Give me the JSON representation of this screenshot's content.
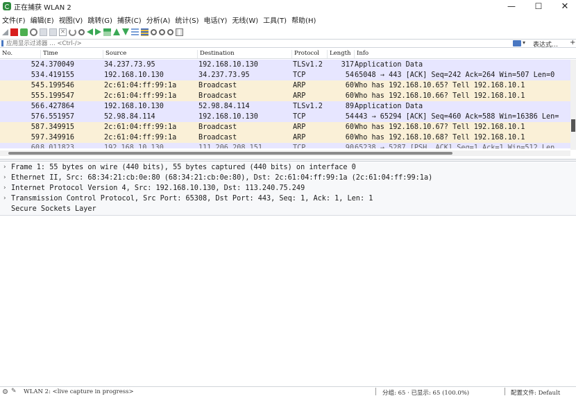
{
  "window": {
    "title": "正在捕获 WLAN 2",
    "minimize": "—",
    "maximize": "☐",
    "close": "✕"
  },
  "menu": [
    "文件(F)",
    "编辑(E)",
    "视图(V)",
    "跳转(G)",
    "捕获(C)",
    "分析(A)",
    "统计(S)",
    "电话(Y)",
    "无线(W)",
    "工具(T)",
    "帮助(H)"
  ],
  "toolbar_icons": [
    "shark-fin-icon",
    "stop-capture-icon",
    "restart-capture-icon",
    "capture-options-icon",
    "open-file-icon",
    "save-file-icon",
    "close-file-icon",
    "reload-icon",
    "find-packet-icon",
    "go-back-icon",
    "go-forward-icon",
    "go-to-packet-icon",
    "go-first-icon",
    "go-last-icon",
    "auto-scroll-icon",
    "colorize-icon",
    "zoom-in-icon",
    "zoom-out-icon",
    "zoom-normal-icon",
    "resize-columns-icon"
  ],
  "filter": {
    "placeholder": "应用显示过滤器 … <Ctrl-/>",
    "dropdown": "▾",
    "expression_label": "表达式…",
    "add_label": "+"
  },
  "columns": [
    "No.",
    "Time",
    "Source",
    "Destination",
    "Protocol",
    "Length",
    "Info"
  ],
  "packets": [
    {
      "no": "52",
      "time": "4.370049",
      "src": "34.237.73.95",
      "dst": "192.168.10.130",
      "proto": "TLSv1.2",
      "len": "317",
      "info": "Application Data",
      "bg": "#e7e6ff"
    },
    {
      "no": "53",
      "time": "4.419155",
      "src": "192.168.10.130",
      "dst": "34.237.73.95",
      "proto": "TCP",
      "len": "54",
      "info": "65048 → 443 [ACK] Seq=242 Ack=264 Win=507 Len=0",
      "bg": "#e7e6ff"
    },
    {
      "no": "54",
      "time": "5.199546",
      "src": "2c:61:04:ff:99:1a",
      "dst": "Broadcast",
      "proto": "ARP",
      "len": "60",
      "info": "Who has 192.168.10.65? Tell 192.168.10.1",
      "bg": "#faf0d7"
    },
    {
      "no": "55",
      "time": "5.199547",
      "src": "2c:61:04:ff:99:1a",
      "dst": "Broadcast",
      "proto": "ARP",
      "len": "60",
      "info": "Who has 192.168.10.66? Tell 192.168.10.1",
      "bg": "#faf0d7"
    },
    {
      "no": "56",
      "time": "6.427864",
      "src": "192.168.10.130",
      "dst": "52.98.84.114",
      "proto": "TLSv1.2",
      "len": "89",
      "info": "Application Data",
      "bg": "#e7e6ff"
    },
    {
      "no": "57",
      "time": "6.551957",
      "src": "52.98.84.114",
      "dst": "192.168.10.130",
      "proto": "TCP",
      "len": "54",
      "info": "443 → 65294 [ACK] Seq=460 Ack=588 Win=16386 Len=",
      "bg": "#e7e6ff"
    },
    {
      "no": "58",
      "time": "7.349915",
      "src": "2c:61:04:ff:99:1a",
      "dst": "Broadcast",
      "proto": "ARP",
      "len": "60",
      "info": "Who has 192.168.10.67? Tell 192.168.10.1",
      "bg": "#faf0d7"
    },
    {
      "no": "59",
      "time": "7.349916",
      "src": "2c:61:04:ff:99:1a",
      "dst": "Broadcast",
      "proto": "ARP",
      "len": "60",
      "info": "Who has 192.168.10.68? Tell 192.168.10.1",
      "bg": "#faf0d7"
    },
    {
      "no": "60",
      "time": "8.011823",
      "src": "192.168.10.130",
      "dst": "111.206.208.151",
      "proto": "TCP",
      "len": "90",
      "info": "65238 → 5287 [PSH, ACK] Seq=1 Ack=1 Win=512 Len",
      "bg": "#e7e6ff"
    }
  ],
  "details": [
    {
      "caret": "›",
      "text": "Frame 1: 55 bytes on wire (440 bits), 55 bytes captured (440 bits) on interface 0"
    },
    {
      "caret": "›",
      "text": "Ethernet II, Src: 68:34:21:cb:0e:80 (68:34:21:cb:0e:80), Dst: 2c:61:04:ff:99:1a (2c:61:04:ff:99:1a)"
    },
    {
      "caret": "›",
      "text": "Internet Protocol Version 4, Src: 192.168.10.130, Dst: 113.240.75.249"
    },
    {
      "caret": "›",
      "text": "Transmission Control Protocol, Src Port: 65308, Dst Port: 443, Seq: 1, Ack: 1, Len: 1"
    },
    {
      "caret": "",
      "text": "Secure Sockets Layer"
    }
  ],
  "status": {
    "interface": "WLAN 2: <live capture in progress>",
    "counts": "分组: 65 · 已显示: 65 (100.0%)",
    "profile": "配置文件: Default"
  },
  "colors": {
    "tcp_row": "#e7e6ff",
    "arp_row": "#faf0d7",
    "stop_red": "#d81e1e",
    "accent_blue": "#4a78c2"
  }
}
